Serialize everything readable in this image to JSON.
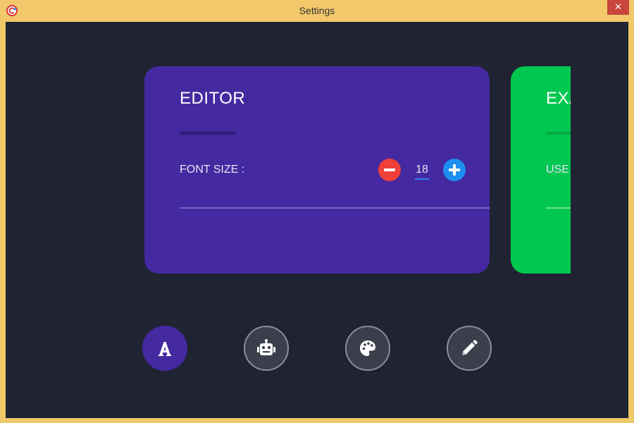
{
  "window": {
    "title": "Settings",
    "close_label": "✕"
  },
  "cards": [
    {
      "title": "EDITOR",
      "setting_label": "FONT SIZE :",
      "font_size_value": "18"
    },
    {
      "title_visible": "EXA",
      "setting_label_visible": "USE"
    }
  ],
  "nav": {
    "items": [
      "font-icon",
      "robot-icon",
      "palette-icon",
      "pencil-icon"
    ],
    "active_index": 0
  },
  "colors": {
    "background": "#1f2332",
    "editor_card": "#4429a0",
    "green_card": "#00c74f",
    "minus_button": "#f0403a",
    "plus_button": "#1c8ff0",
    "title_bar": "#f2c86a",
    "close_button": "#c9463d"
  }
}
